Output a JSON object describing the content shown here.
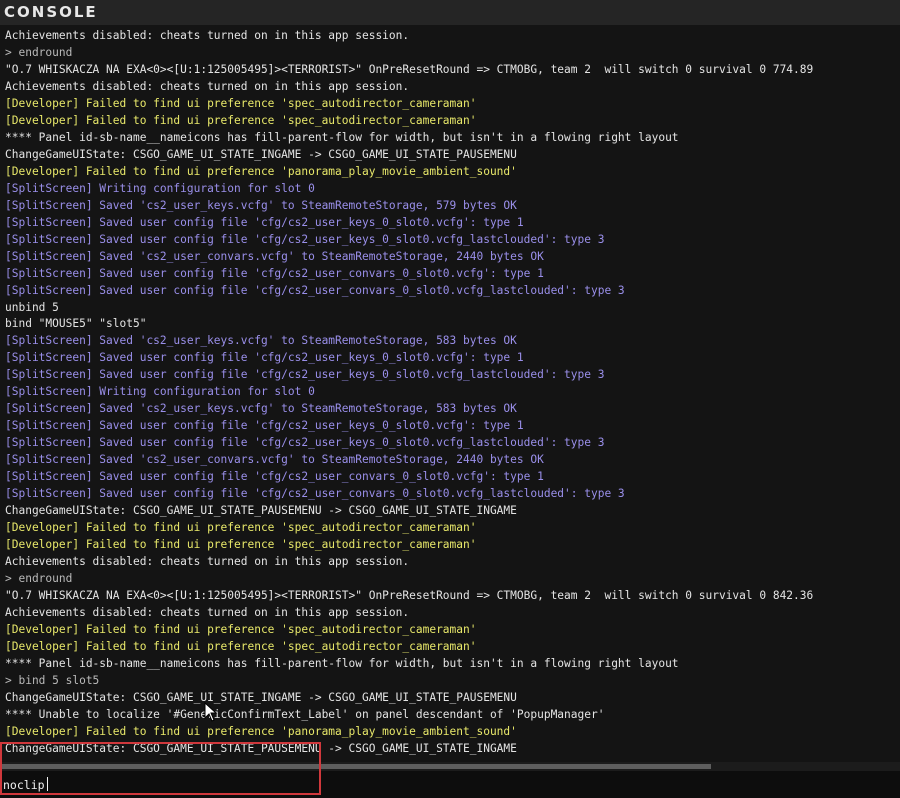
{
  "window": {
    "title": "CONSOLE"
  },
  "log": [
    {
      "kind": "plain",
      "text": "Achievements disabled: cheats turned on in this app session."
    },
    {
      "kind": "cmd",
      "text": "> endround"
    },
    {
      "kind": "plain",
      "text": "\"O.7 WHISKACZA NA EXA<0><[U:1:125005495]><TERRORIST>\" OnPreResetRound => CTMOBG, team 2  will switch 0 survival 0 774.89"
    },
    {
      "kind": "plain",
      "text": "Achievements disabled: cheats turned on in this app session."
    },
    {
      "kind": "dev",
      "text": "[Developer] Failed to find ui preference 'spec_autodirector_cameraman'"
    },
    {
      "kind": "dev",
      "text": "[Developer] Failed to find ui preference 'spec_autodirector_cameraman'"
    },
    {
      "kind": "plain",
      "text": "**** Panel id-sb-name__nameicons has fill-parent-flow for width, but isn't in a flowing right layout"
    },
    {
      "kind": "plain",
      "text": "ChangeGameUIState: CSGO_GAME_UI_STATE_INGAME -> CSGO_GAME_UI_STATE_PAUSEMENU"
    },
    {
      "kind": "dev",
      "text": "[Developer] Failed to find ui preference 'panorama_play_movie_ambient_sound'"
    },
    {
      "kind": "split",
      "text": "[SplitScreen] Writing configuration for slot 0"
    },
    {
      "kind": "split",
      "text": "[SplitScreen] Saved 'cs2_user_keys.vcfg' to SteamRemoteStorage, 579 bytes OK"
    },
    {
      "kind": "split",
      "text": "[SplitScreen] Saved user config file 'cfg/cs2_user_keys_0_slot0.vcfg': type 1"
    },
    {
      "kind": "split",
      "text": "[SplitScreen] Saved user config file 'cfg/cs2_user_keys_0_slot0.vcfg_lastclouded': type 3"
    },
    {
      "kind": "split",
      "text": "[SplitScreen] Saved 'cs2_user_convars.vcfg' to SteamRemoteStorage, 2440 bytes OK"
    },
    {
      "kind": "split",
      "text": "[SplitScreen] Saved user config file 'cfg/cs2_user_convars_0_slot0.vcfg': type 1"
    },
    {
      "kind": "split",
      "text": "[SplitScreen] Saved user config file 'cfg/cs2_user_convars_0_slot0.vcfg_lastclouded': type 3"
    },
    {
      "kind": "plain",
      "text": "unbind 5"
    },
    {
      "kind": "plain",
      "text": "bind \"MOUSE5\" \"slot5\""
    },
    {
      "kind": "split",
      "text": "[SplitScreen] Saved 'cs2_user_keys.vcfg' to SteamRemoteStorage, 583 bytes OK"
    },
    {
      "kind": "split",
      "text": "[SplitScreen] Saved user config file 'cfg/cs2_user_keys_0_slot0.vcfg': type 1"
    },
    {
      "kind": "split",
      "text": "[SplitScreen] Saved user config file 'cfg/cs2_user_keys_0_slot0.vcfg_lastclouded': type 3"
    },
    {
      "kind": "split",
      "text": "[SplitScreen] Writing configuration for slot 0"
    },
    {
      "kind": "split",
      "text": "[SplitScreen] Saved 'cs2_user_keys.vcfg' to SteamRemoteStorage, 583 bytes OK"
    },
    {
      "kind": "split",
      "text": "[SplitScreen] Saved user config file 'cfg/cs2_user_keys_0_slot0.vcfg': type 1"
    },
    {
      "kind": "split",
      "text": "[SplitScreen] Saved user config file 'cfg/cs2_user_keys_0_slot0.vcfg_lastclouded': type 3"
    },
    {
      "kind": "split",
      "text": "[SplitScreen] Saved 'cs2_user_convars.vcfg' to SteamRemoteStorage, 2440 bytes OK"
    },
    {
      "kind": "split",
      "text": "[SplitScreen] Saved user config file 'cfg/cs2_user_convars_0_slot0.vcfg': type 1"
    },
    {
      "kind": "split",
      "text": "[SplitScreen] Saved user config file 'cfg/cs2_user_convars_0_slot0.vcfg_lastclouded': type 3"
    },
    {
      "kind": "plain",
      "text": "ChangeGameUIState: CSGO_GAME_UI_STATE_PAUSEMENU -> CSGO_GAME_UI_STATE_INGAME"
    },
    {
      "kind": "dev",
      "text": "[Developer] Failed to find ui preference 'spec_autodirector_cameraman'"
    },
    {
      "kind": "dev",
      "text": "[Developer] Failed to find ui preference 'spec_autodirector_cameraman'"
    },
    {
      "kind": "plain",
      "text": "Achievements disabled: cheats turned on in this app session."
    },
    {
      "kind": "cmd",
      "text": "> endround"
    },
    {
      "kind": "plain",
      "text": "\"O.7 WHISKACZA NA EXA<0><[U:1:125005495]><TERRORIST>\" OnPreResetRound => CTMOBG, team 2  will switch 0 survival 0 842.36"
    },
    {
      "kind": "plain",
      "text": "Achievements disabled: cheats turned on in this app session."
    },
    {
      "kind": "dev",
      "text": "[Developer] Failed to find ui preference 'spec_autodirector_cameraman'"
    },
    {
      "kind": "dev",
      "text": "[Developer] Failed to find ui preference 'spec_autodirector_cameraman'"
    },
    {
      "kind": "plain",
      "text": "**** Panel id-sb-name__nameicons has fill-parent-flow for width, but isn't in a flowing right layout"
    },
    {
      "kind": "cmd",
      "text": "> bind 5 slot5"
    },
    {
      "kind": "plain",
      "text": "ChangeGameUIState: CSGO_GAME_UI_STATE_INGAME -> CSGO_GAME_UI_STATE_PAUSEMENU"
    },
    {
      "kind": "plain",
      "text": "**** Unable to localize '#GenericConfirmText_Label' on panel descendant of 'PopupManager'"
    },
    {
      "kind": "dev",
      "text": "[Developer] Failed to find ui preference 'panorama_play_movie_ambient_sound'"
    },
    {
      "kind": "plain",
      "text": "ChangeGameUIState: CSGO_GAME_UI_STATE_PAUSEMENU -> CSGO_GAME_UI_STATE_INGAME"
    }
  ],
  "input": {
    "value": "noclip"
  },
  "scrollbar": {
    "thumb_fraction": 0.79
  }
}
